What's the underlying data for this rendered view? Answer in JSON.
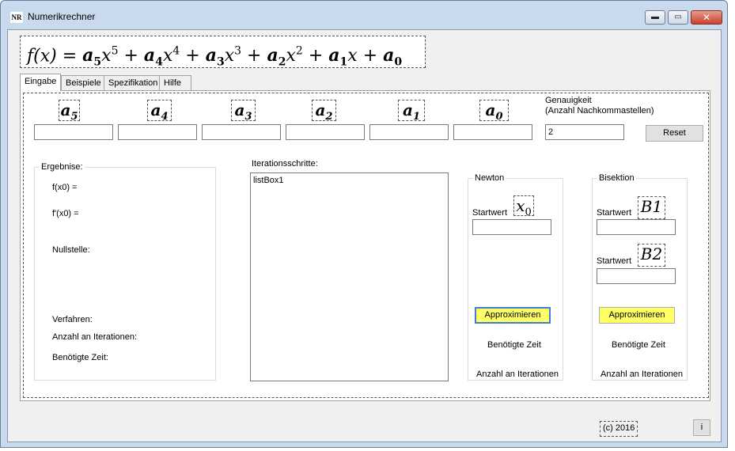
{
  "window": {
    "icon_text": "NR",
    "title": "Numerikrechner",
    "min_symbol": "▬",
    "max_symbol": "▭",
    "close_symbol": "✕"
  },
  "formula": {
    "prefix": "f(x) = ",
    "terms": [
      {
        "coef": "a",
        "sub": "5",
        "var": "x",
        "exp": "5"
      },
      {
        "coef": "a",
        "sub": "4",
        "var": "x",
        "exp": "4"
      },
      {
        "coef": "a",
        "sub": "3",
        "var": "x",
        "exp": "3"
      },
      {
        "coef": "a",
        "sub": "2",
        "var": "x",
        "exp": "2"
      },
      {
        "coef": "a",
        "sub": "1",
        "var": "x",
        "exp": ""
      },
      {
        "coef": "a",
        "sub": "0",
        "var": "",
        "exp": ""
      }
    ]
  },
  "tabs": [
    "Eingabe",
    "Beispiele",
    "Spezifikation",
    "Hilfe"
  ],
  "coefficients": [
    {
      "letter": "a",
      "sub": "5",
      "value": ""
    },
    {
      "letter": "a",
      "sub": "4",
      "value": ""
    },
    {
      "letter": "a",
      "sub": "3",
      "value": ""
    },
    {
      "letter": "a",
      "sub": "2",
      "value": ""
    },
    {
      "letter": "a",
      "sub": "1",
      "value": ""
    },
    {
      "letter": "a",
      "sub": "0",
      "value": ""
    }
  ],
  "precision": {
    "label_line1": "Genauigkeit",
    "label_line2": "(Anzahl Nachkommastellen)",
    "value": "2"
  },
  "reset_label": "Reset",
  "results": {
    "title": "Ergebnise:",
    "fx0": "f(x0) =",
    "dfx0": "f'(x0) =",
    "root": "Nullstelle:",
    "method": "Verfahren:",
    "iterations": "Anzahl an Iterationen:",
    "time": "Benötigte Zeit:"
  },
  "iterations_panel": {
    "title": "Iterationsschritte:",
    "list_items": [
      "listBox1"
    ]
  },
  "newton": {
    "title": "Newton",
    "start_label": "Startwert",
    "var_letter": "x",
    "var_sub": "0",
    "start_value": "",
    "button": "Approximieren",
    "time_label": "Benötigte Zeit",
    "iter_label": "Anzahl an Iterationen"
  },
  "bisection": {
    "title": "Bisektion",
    "start_label_1": "Startwert",
    "var_1": "B1",
    "value_1": "",
    "start_label_2": "Startwert",
    "var_2": "B2",
    "value_2": "",
    "button": "Approximieren",
    "time_label": "Benötigte Zeit",
    "iter_label": "Anzahl an Iterationen"
  },
  "footer": {
    "copyright": "(c) 2016",
    "info_button": "i"
  }
}
